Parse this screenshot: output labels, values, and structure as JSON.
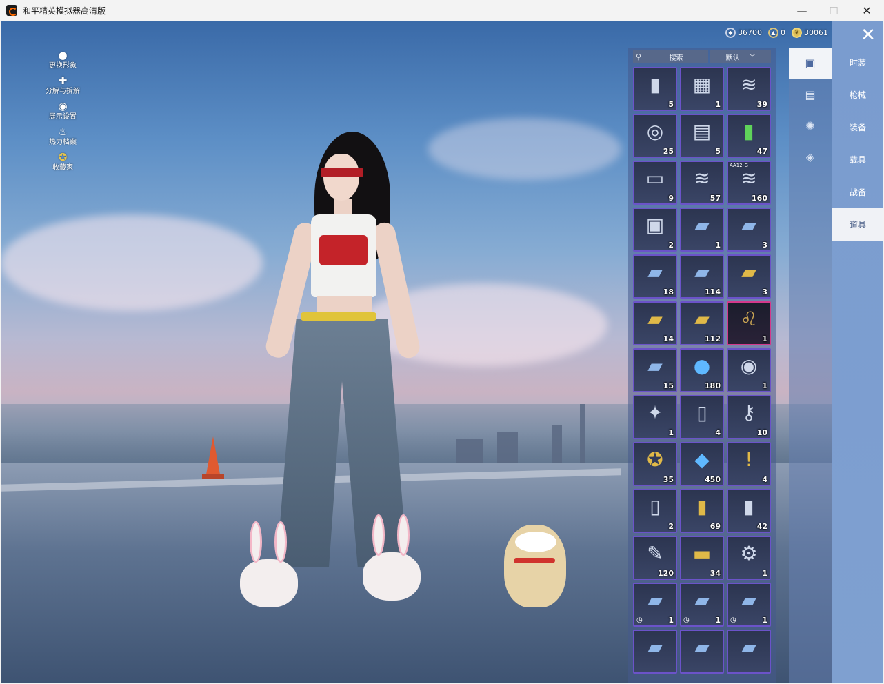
{
  "window": {
    "title": "和平精英模拟器高清版"
  },
  "left_menu": [
    {
      "label": "更换形象",
      "icon": "person-icon"
    },
    {
      "label": "分解与拆解",
      "icon": "puzzle-icon"
    },
    {
      "label": "展示设置",
      "icon": "eye-icon"
    },
    {
      "label": "热力档案",
      "icon": "flame-icon"
    },
    {
      "label": "收藏家",
      "icon": "badge-icon"
    }
  ],
  "currency": [
    {
      "value": "36700",
      "icon": "coin-silver-icon"
    },
    {
      "value": "0",
      "icon": "coin-badge-icon"
    },
    {
      "value": "30061",
      "icon": "coin-gold-icon"
    }
  ],
  "inventory": {
    "search_label": "搜索",
    "sort_label": "默认",
    "items": [
      {
        "icon": "spray-can-icon",
        "count": "5"
      },
      {
        "icon": "parts-box-icon",
        "count": "1"
      },
      {
        "icon": "spring-icon",
        "count": "39"
      },
      {
        "icon": "disc-icon",
        "count": "25"
      },
      {
        "icon": "cards-icon",
        "count": "5"
      },
      {
        "icon": "green-spray-icon",
        "count": "47"
      },
      {
        "icon": "tray-icon",
        "count": "9"
      },
      {
        "icon": "spring-icon",
        "count": "57"
      },
      {
        "icon": "spring-icon",
        "count": "160",
        "tag": "AA12-G"
      },
      {
        "icon": "id-card-icon",
        "count": "2"
      },
      {
        "icon": "ticket-1day-icon",
        "count": "1"
      },
      {
        "icon": "ticket-3day-icon",
        "count": "3"
      },
      {
        "icon": "ticket-3day-icon",
        "count": "18"
      },
      {
        "icon": "ticket-2hour-icon",
        "count": "114"
      },
      {
        "icon": "gold-ticket-1day-icon",
        "count": "3"
      },
      {
        "icon": "gold-ticket-3day-icon",
        "count": "14"
      },
      {
        "icon": "gold-ticket-2hour-icon",
        "count": "112"
      },
      {
        "icon": "lion-emblem-icon",
        "count": "1",
        "highlight": true
      },
      {
        "icon": "match-ticket-icon",
        "count": "15"
      },
      {
        "icon": "puzzle-orb-icon",
        "count": "180"
      },
      {
        "icon": "silver-coin-icon",
        "count": "1"
      },
      {
        "icon": "medal-icon",
        "count": "1"
      },
      {
        "icon": "card-icon",
        "count": "4"
      },
      {
        "icon": "key-icon",
        "count": "10"
      },
      {
        "icon": "star-coin-icon",
        "count": "35"
      },
      {
        "icon": "diamond-icon",
        "count": "450"
      },
      {
        "icon": "alert-card-icon",
        "count": "4"
      },
      {
        "icon": "blue-card-icon",
        "count": "2"
      },
      {
        "icon": "canister-icon",
        "count": "69"
      },
      {
        "icon": "spray-bottle-icon",
        "count": "42"
      },
      {
        "icon": "spray-gun-icon",
        "count": "120"
      },
      {
        "icon": "gold-ticket-icon",
        "count": "34"
      },
      {
        "icon": "gear-emblem-icon",
        "count": "1"
      },
      {
        "icon": "event-ticket-icon",
        "count": "1",
        "timed": true
      },
      {
        "icon": "ticket-icon",
        "count": "1",
        "timed": true
      },
      {
        "icon": "ticket-icon",
        "count": "1",
        "timed": true
      },
      {
        "icon": "ticket-icon",
        "count": ""
      },
      {
        "icon": "ticket-icon",
        "count": ""
      },
      {
        "icon": "ticket-icon",
        "count": ""
      }
    ]
  },
  "side_icons": [
    {
      "icon": "item-card-icon",
      "active": true
    },
    {
      "icon": "calendar-icon",
      "active": false
    },
    {
      "icon": "sparkle-icon",
      "active": false
    },
    {
      "icon": "tag-icon",
      "active": false
    }
  ],
  "tabs": [
    {
      "label": "时装",
      "active": false
    },
    {
      "label": "枪械",
      "active": false
    },
    {
      "label": "装备",
      "active": false
    },
    {
      "label": "载具",
      "active": false
    },
    {
      "label": "战备",
      "active": false
    },
    {
      "label": "道具",
      "active": true
    }
  ]
}
